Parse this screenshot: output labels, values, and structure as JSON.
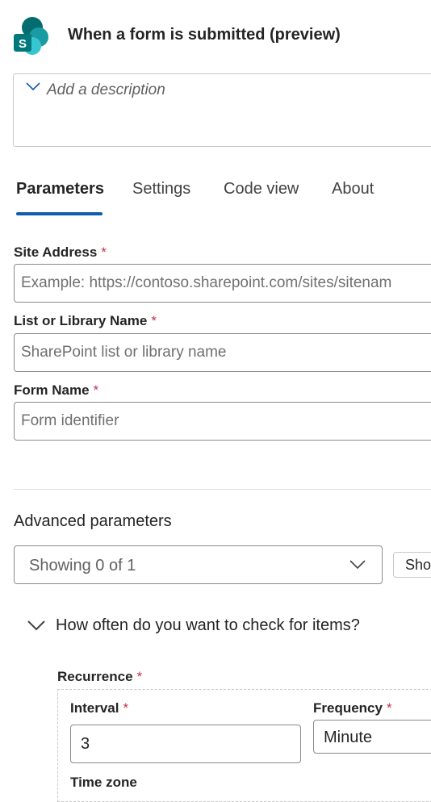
{
  "header": {
    "title": "When a form is submitted (preview)",
    "icon": "sharepoint-icon",
    "icon_letter": "S"
  },
  "description": {
    "placeholder": "Add a description"
  },
  "tabs": [
    {
      "label": "Parameters",
      "active": true
    },
    {
      "label": "Settings",
      "active": false
    },
    {
      "label": "Code view",
      "active": false
    },
    {
      "label": "About",
      "active": false
    }
  ],
  "fields": {
    "site_address": {
      "label": "Site Address",
      "required_mark": "*",
      "placeholder": "Example: https://contoso.sharepoint.com/sites/sitenam",
      "value": ""
    },
    "list_name": {
      "label": "List or Library Name",
      "required_mark": "*",
      "placeholder": "SharePoint list or library name",
      "value": ""
    },
    "form_name": {
      "label": "Form Name",
      "required_mark": "*",
      "placeholder": "Form identifier",
      "value": ""
    }
  },
  "advanced": {
    "label": "Advanced parameters",
    "dropdown_text": "Showing 0 of 1",
    "show_button": "Show"
  },
  "section": {
    "title": "How often do you want to check for items?",
    "recurrence": {
      "label": "Recurrence",
      "required_mark": "*",
      "interval_label": "Interval",
      "interval_value": "3",
      "frequency_label": "Frequency",
      "frequency_value": "Minute",
      "timezone_label": "Time zone"
    }
  },
  "colors": {
    "accent": "#0f5da8",
    "required": "#c4314b"
  }
}
